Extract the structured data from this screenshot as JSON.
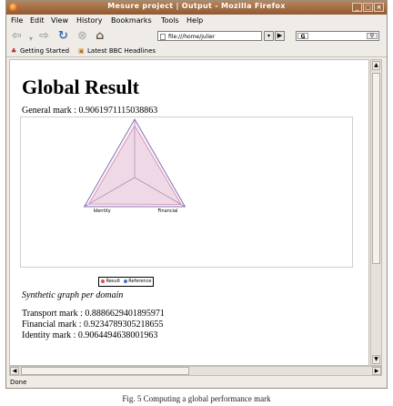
{
  "window": {
    "title": "Mesure project | Output - Mozilla Firefox",
    "menu": [
      "File",
      "Edit",
      "View",
      "History",
      "Bookmarks",
      "Tools",
      "Help"
    ],
    "url": "file:///home/julier",
    "search_engine": "G",
    "bookmarks": [
      "Getting Started",
      "Latest BBC Headlines"
    ],
    "status": "Done"
  },
  "page": {
    "heading": "Global Result",
    "general_mark": "General mark : 0.9061971115038863",
    "graph_caption": "Synthetic graph per domain",
    "domain_marks": [
      "Transport mark : 0.8886629401895971",
      "Financial mark : 0.9234789305218655",
      "Identity mark : 0.9064494638001963"
    ]
  },
  "chart_data": {
    "type": "radar",
    "axes": [
      "Transport",
      "Financial",
      "Identity"
    ],
    "series": [
      {
        "name": "Result",
        "values": [
          0.8887,
          0.9235,
          0.9064
        ],
        "color": "#d98fb6"
      },
      {
        "name": "Reference",
        "values": [
          1.0,
          1.0,
          1.0
        ],
        "color": "#7f6fb5"
      }
    ],
    "range": [
      0,
      1
    ]
  },
  "figure_caption": "Fig. 5 Computing a global performance mark"
}
